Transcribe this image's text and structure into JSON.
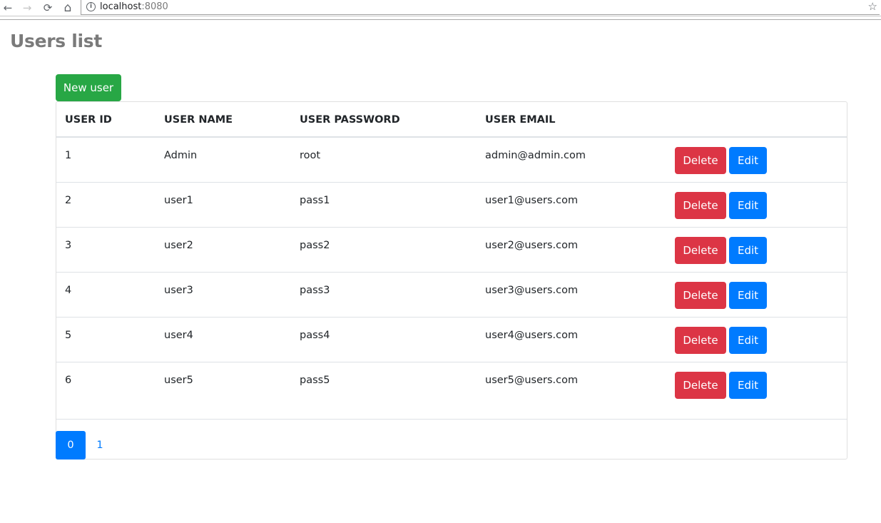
{
  "browser": {
    "url_host": "localhost",
    "url_port": ":8080",
    "back_glyph": "←",
    "forward_glyph": "→",
    "reload_glyph": "⟳",
    "home_glyph": "⌂",
    "info_glyph": "i",
    "star_glyph": "☆"
  },
  "page": {
    "title": "Users list",
    "new_user_label": "New user"
  },
  "table": {
    "headers": {
      "id": "USER ID",
      "name": "USER NAME",
      "password": "USER PASSWORD",
      "email": "USER EMAIL"
    },
    "delete_label": "Delete",
    "edit_label": "Edit",
    "rows": [
      {
        "id": "1",
        "name": "Admin",
        "password": "root",
        "email": "admin@admin.com"
      },
      {
        "id": "2",
        "name": "user1",
        "password": "pass1",
        "email": "user1@users.com"
      },
      {
        "id": "3",
        "name": "user2",
        "password": "pass2",
        "email": "user2@users.com"
      },
      {
        "id": "4",
        "name": "user3",
        "password": "pass3",
        "email": "user3@users.com"
      },
      {
        "id": "5",
        "name": "user4",
        "password": "pass4",
        "email": "user4@users.com"
      },
      {
        "id": "6",
        "name": "user5",
        "password": "pass5",
        "email": "user5@users.com"
      }
    ]
  },
  "pagination": {
    "pages": [
      "0",
      "1"
    ],
    "active_color": "#007bff"
  },
  "colors": {
    "success": "#28a745",
    "danger": "#dc3545",
    "primary": "#007bff",
    "title_gray": "#7a7a7a"
  }
}
